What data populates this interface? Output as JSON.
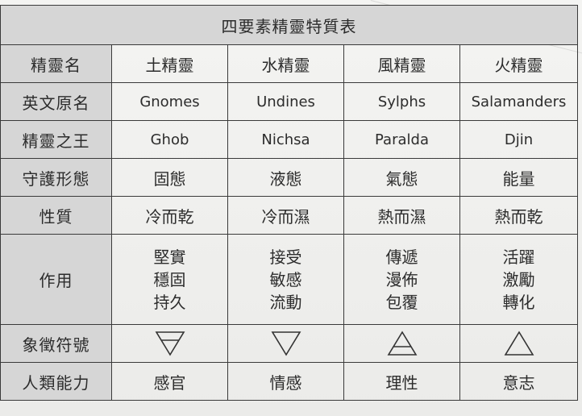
{
  "table": {
    "title": "四要素精靈特質表",
    "header_row": {
      "label": "精靈名",
      "cells": [
        "土精靈",
        "水精靈",
        "風精靈",
        "火精靈"
      ]
    },
    "rows": [
      {
        "label": "英文原名",
        "cells": [
          "Gnomes",
          "Undines",
          "Sylphs",
          "Salamanders"
        ]
      },
      {
        "label": "精靈之王",
        "cells": [
          "Ghob",
          "Nichsa",
          "Paralda",
          "Djin"
        ]
      },
      {
        "label": "守護形態",
        "cells": [
          "固態",
          "液態",
          "氣態",
          "能量"
        ]
      },
      {
        "label": "性質",
        "cells": [
          "冷而乾",
          "冷而濕",
          "熱而濕",
          "熱而乾"
        ]
      }
    ],
    "effect_row": {
      "label": "作用",
      "cells": [
        [
          "堅實",
          "穩固",
          "持久"
        ],
        [
          "接受",
          "敏感",
          "流動"
        ],
        [
          "傳遞",
          "漫佈",
          "包覆"
        ],
        [
          "活躍",
          "激勵",
          "轉化"
        ]
      ]
    },
    "symbol_row": {
      "label": "象徵符號",
      "symbols": [
        "earth-symbol-icon",
        "water-symbol-icon",
        "air-symbol-icon",
        "fire-symbol-icon"
      ]
    },
    "ability_row": {
      "label": "人類能力",
      "cells": [
        "感官",
        "情感",
        "理性",
        "意志"
      ]
    }
  }
}
